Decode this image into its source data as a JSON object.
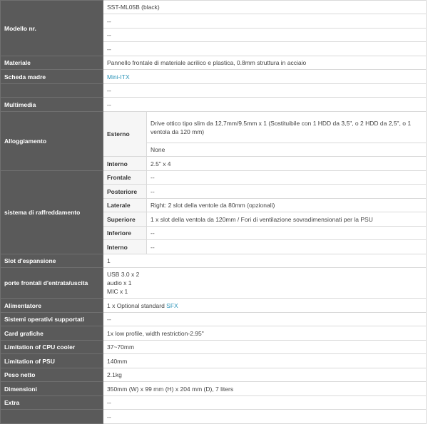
{
  "rows": {
    "model": {
      "label": "Modello nr.",
      "values": [
        "SST-ML05B (black)",
        "--",
        "--",
        "--"
      ]
    },
    "material": {
      "label": "Materiale",
      "value": "Pannello frontale di materiale acrilico e plastica, 0.8mm struttura in acciaio"
    },
    "motherboard": {
      "label": "Scheda madre",
      "values": [
        "Mini-ITX",
        "--"
      ]
    },
    "multimedia": {
      "label": "Multimedia",
      "value": "--"
    },
    "housing": {
      "label": "Alloggiamento",
      "external_label": "Esterno",
      "external_values": [
        "Drive ottico tipo slim da 12,7mm/9.5mm x 1 (Sostituibile con 1 HDD da 3,5\", o 2 HDD da 2,5\", o 1 ventola da 120 mm)",
        "None"
      ],
      "internal_label": "Interno",
      "internal_value": "2.5\" x 4"
    },
    "cooling": {
      "label": "sistema di raffreddamento",
      "items": [
        {
          "label": "Frontale",
          "value": "--"
        },
        {
          "label": "Posteriore",
          "value": "--"
        },
        {
          "label": "Laterale",
          "value": "Right: 2 slot della ventole da 80mm (opzionali)"
        },
        {
          "label": "Superiore",
          "value": "1 x slot della ventola da 120mm / Fori di ventilazione sovradimensionati per la PSU"
        },
        {
          "label": "Inferiore",
          "value": "--"
        },
        {
          "label": "Interno",
          "value": "--"
        }
      ]
    },
    "expansion": {
      "label": "Slot d'espansione",
      "value": "1"
    },
    "front_io": {
      "label": "porte frontali d'entrata/uscita",
      "lines": [
        "USB 3.0 x 2",
        "audio x 1",
        "MIC x 1"
      ]
    },
    "psu": {
      "label": "Alimentatore",
      "prefix": "1 x Optional standard ",
      "link": "SFX"
    },
    "os": {
      "label": "Sistemi operativi supportati",
      "value": "--"
    },
    "gpu": {
      "label": "Card grafiche",
      "value": "1x low profile, width restriction-2.95\""
    },
    "cpu_cooler": {
      "label": "Limitation of CPU cooler",
      "value": "37~70mm"
    },
    "psu_limit": {
      "label": "Limitation of PSU",
      "value": "140mm"
    },
    "weight": {
      "label": "Peso netto",
      "value": "2.1kg"
    },
    "dimensions": {
      "label": "Dimensioni",
      "value": "350mm (W) x 99 mm (H) x 204 mm (D), 7 liters"
    },
    "extra": {
      "label": "Extra",
      "values": [
        "--",
        "--"
      ]
    }
  },
  "colors": {
    "label_bg": "#5a5a5a",
    "link": "#2a93b8",
    "border": "#d9d9d9"
  }
}
